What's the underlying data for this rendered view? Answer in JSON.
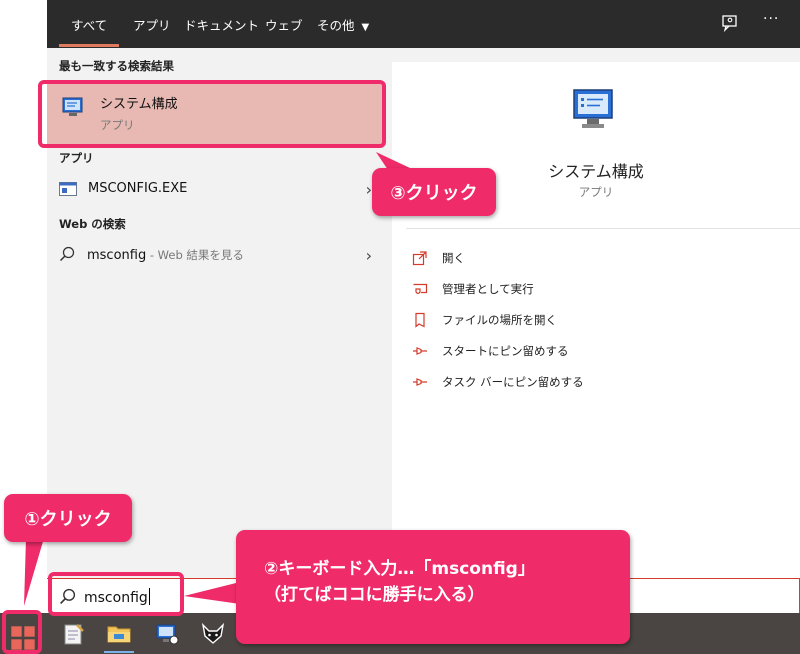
{
  "tabs": [
    "すべて",
    "アプリ",
    "ドキュメント",
    "ウェブ",
    "その他"
  ],
  "active_tab": "すべて",
  "left": {
    "best_match_heading": "最も一致する検索結果",
    "best_match": {
      "title": "システム構成",
      "subtitle": "アプリ"
    },
    "apps_heading": "アプリ",
    "app_item": "MSCONFIG.EXE",
    "web_heading": "Web の検索",
    "web_item": {
      "query": "msconfig",
      "suffix": " - Web 結果を見る"
    }
  },
  "preview": {
    "title": "システム構成",
    "subtitle": "アプリ",
    "actions": [
      "開く",
      "管理者として実行",
      "ファイルの場所を開く",
      "スタートにピン留めする",
      "タスク バーにピン留めする"
    ]
  },
  "search": {
    "text": "msconfig"
  },
  "annotations": {
    "step1": "①クリック",
    "step2_line1": "②キーボード入力…「msconfig」",
    "step2_line2": "（打てばココに勝手に入る）",
    "step3": "③クリック"
  },
  "colors": {
    "highlight": "#ef2b6a",
    "accent": "#d43b2b",
    "best_match_bg": "#e8b9b2"
  }
}
